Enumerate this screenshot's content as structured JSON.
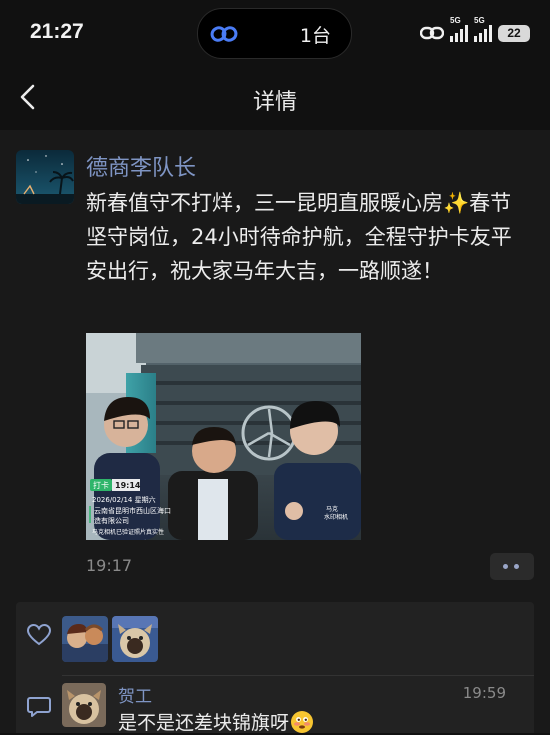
{
  "status_bar": {
    "time": "21:27",
    "island_count": "1台",
    "network_1": "5G",
    "network_2": "5G",
    "battery": "22"
  },
  "nav": {
    "back_icon": "chevron-left-icon",
    "title": "详情"
  },
  "post": {
    "author": "德商李队长",
    "text": "新春值守不打烊，三一昆明直服暖心房✨春节坚守岗位，24小时待命护航，全程守护卡友平安出行，祝大家马年大吉，一路顺遂！",
    "time": "19:17",
    "photo": {
      "watermark_tag": "打卡",
      "watermark_time": "19:14",
      "watermark_date": "2026/02/14 星期六",
      "watermark_loc1": "云南省昆明市西山区海口",
      "watermark_loc2": "造有限公司",
      "watermark_verify": "马克相机已验证照片真实性",
      "corner_brand": "马克",
      "corner_sub": "水印相机"
    }
  },
  "likes": {
    "icon": "heart-icon",
    "count_avatars": 2
  },
  "comment": {
    "icon": "comment-icon",
    "author": "贺工",
    "time": "19:59",
    "text": "是不是还差块锦旗呀"
  },
  "colors": {
    "background": "#111111",
    "panel": "#191919",
    "likes_panel": "#222222",
    "name_link": "#7f95c4",
    "text": "#ececec",
    "muted": "#8a8a8a"
  }
}
